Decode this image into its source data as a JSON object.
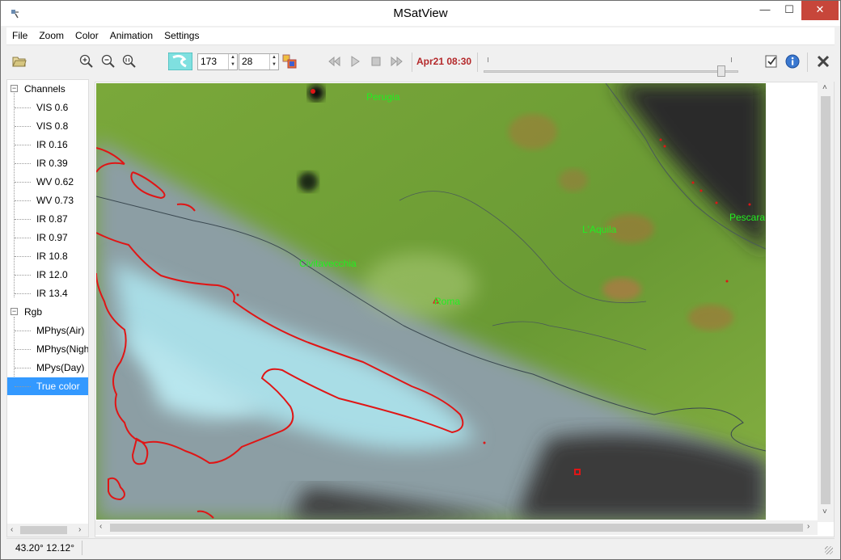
{
  "window": {
    "title": "MSatView"
  },
  "menu": [
    "File",
    "Zoom",
    "Color",
    "Animation",
    "Settings"
  ],
  "toolbar": {
    "spin_a": "173",
    "spin_b": "28",
    "datetime": "Apr21 08:30",
    "slider_fraction": 0.95
  },
  "tree": {
    "channels_label": "Channels",
    "channels": [
      "VIS 0.6",
      "VIS 0.8",
      "IR 0.16",
      "IR 0.39",
      "WV 0.62",
      "WV 0.73",
      "IR 0.87",
      "IR 0.97",
      "IR 10.8",
      "IR 12.0",
      "IR 13.4"
    ],
    "rgb_label": "Rgb",
    "rgb": [
      "MPhys(Air)",
      "MPhys(Night)",
      "MPys(Day)",
      "True color"
    ],
    "selected": "True color"
  },
  "map": {
    "cities": [
      "Perugia",
      "Pescara",
      "L'Aquila",
      "Civitavecchia",
      "Roma"
    ],
    "label_color": "#22ee22",
    "coast_color": "#e01515"
  },
  "status": {
    "coords": "43.20° 12.12°"
  },
  "colors": {
    "datetime": "#b4282a",
    "selection": "#3399ff",
    "close": "#c7463a"
  }
}
